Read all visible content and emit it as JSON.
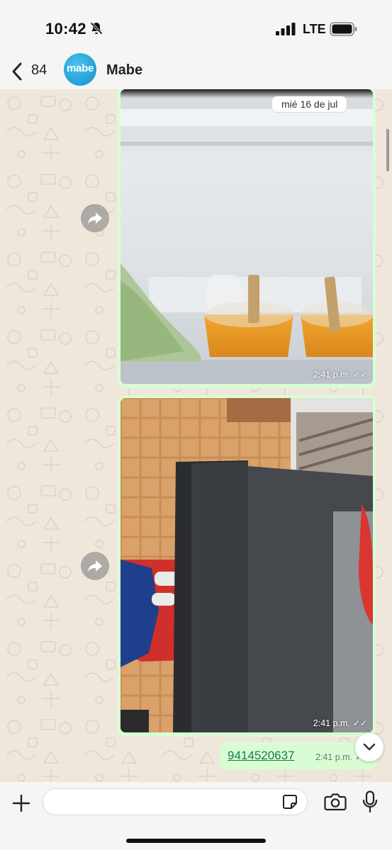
{
  "status_bar": {
    "time": "10:42",
    "network": "LTE"
  },
  "header": {
    "back_count": "84",
    "contact_name": "Mabe",
    "avatar_text": "mabe"
  },
  "chat": {
    "date_chip": "mié 16 de jul",
    "messages": [
      {
        "type": "image",
        "time": "2:41 p.m.",
        "ticks": "✓✓"
      },
      {
        "type": "image",
        "time": "2:41 p.m.",
        "ticks": "✓✓"
      },
      {
        "type": "text",
        "text": "9414520637",
        "time": "2:41 p.m.",
        "ticks": "✓✓"
      }
    ]
  },
  "input": {
    "placeholder": ""
  },
  "icons": {
    "bell": "bell-slash-icon",
    "signal": "signal-icon",
    "battery": "battery-icon",
    "back": "chevron-left-icon",
    "forward": "forward-icon",
    "scroll": "chevron-down-icon",
    "plus": "plus-icon",
    "sticker": "sticker-icon",
    "camera": "camera-icon",
    "mic": "microphone-icon"
  },
  "colors": {
    "outgoing_bubble": "#d9fdd3",
    "link": "#18794e",
    "chat_bg": "#efe7dc",
    "avatar": "#1a9fd6"
  }
}
